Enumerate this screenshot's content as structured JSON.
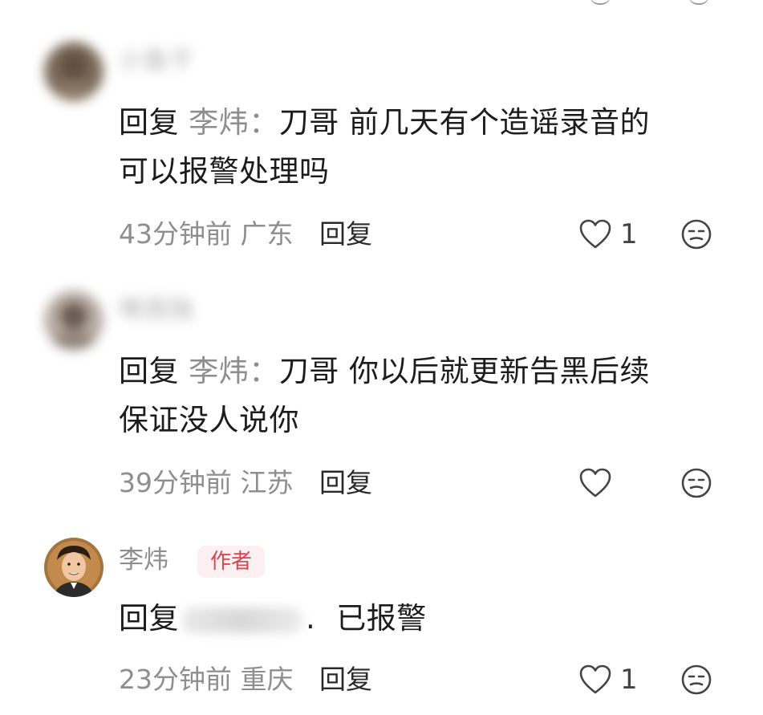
{
  "comments": [
    {
      "username": "小鱼干",
      "reply_keyword": "回复",
      "reply_to": "李炜：",
      "text_line1": "刀哥 前几天有个造谣录音的",
      "text_line2": "可以报警处理吗",
      "time": "43分钟前",
      "location": "广东",
      "reply_label": "回复",
      "like_count": "1"
    },
    {
      "username": "唯我独",
      "reply_keyword": "回复",
      "reply_to": "李炜：",
      "text_line1": "刀哥 你以后就更新告黑后续",
      "text_line2": "保证没人说你",
      "time": "39分钟前",
      "location": "江苏",
      "reply_label": "回复",
      "like_count": ""
    },
    {
      "username": "李炜",
      "author_badge": "作者",
      "reply_keyword": "回复",
      "reply_separator": ".",
      "text_line1": "已报警",
      "time": "23分钟前",
      "location": "重庆",
      "reply_label": "回复",
      "like_count": "1"
    }
  ]
}
